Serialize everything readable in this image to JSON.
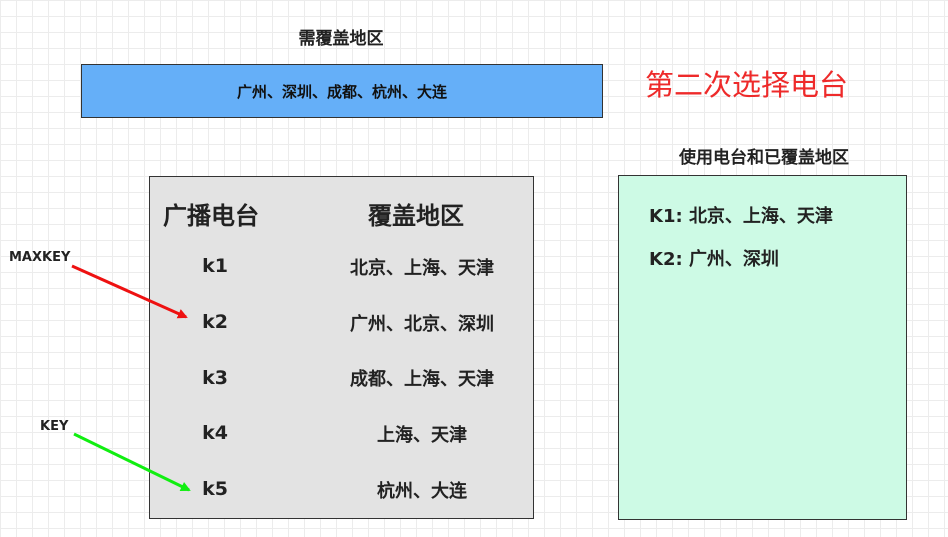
{
  "header": {
    "need_title": "需覆盖地区",
    "need_areas": "广州、深圳、成都、杭州、大连",
    "round_title": "第二次选择电台",
    "used_title": "使用电台和已覆盖地区"
  },
  "table": {
    "col_station": "广播电台",
    "col_area": "覆盖地区",
    "rows": [
      {
        "key": "k1",
        "areas": "北京、上海、天津"
      },
      {
        "key": "k2",
        "areas": "广州、北京、深圳"
      },
      {
        "key": "k3",
        "areas": "成都、上海、天津"
      },
      {
        "key": "k4",
        "areas": "上海、天津"
      },
      {
        "key": "k5",
        "areas": "杭州、大连"
      }
    ]
  },
  "used": {
    "lines": [
      "K1: 北京、上海、天津",
      "K2: 广州、深圳"
    ]
  },
  "pointers": {
    "maxkey_label": "MAXKEY",
    "key_label": "KEY",
    "maxkey_color": "#ee1111",
    "key_color": "#11ee11"
  },
  "colors": {
    "need_box": "#65aff8",
    "station_box": "#e3e3e3",
    "used_box": "#cdfae5",
    "round_title": "#ee2a2a"
  }
}
